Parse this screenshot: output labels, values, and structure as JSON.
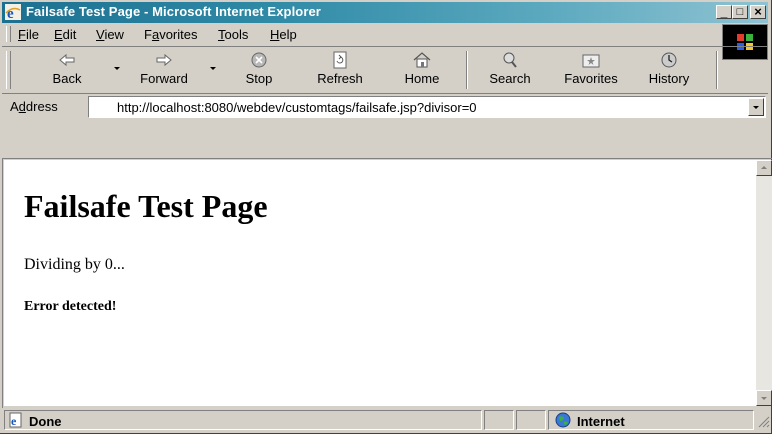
{
  "window": {
    "title": "Failsafe Test Page - Microsoft Internet Explorer",
    "min_glyph": "_",
    "max_glyph": "□",
    "close_glyph": "×"
  },
  "menu": {
    "items": [
      {
        "underline": "F",
        "rest": "ile"
      },
      {
        "underline": "E",
        "rest": "dit"
      },
      {
        "underline": "V",
        "rest": "iew"
      },
      {
        "pre": "F",
        "underline": "a",
        "rest": "vorites"
      },
      {
        "underline": "T",
        "rest": "ools"
      },
      {
        "underline": "H",
        "rest": "elp"
      }
    ]
  },
  "toolbar": {
    "back": "Back",
    "forward": "Forward",
    "stop": "Stop",
    "refresh": "Refresh",
    "home": "Home",
    "search": "Search",
    "favorites": "Favorites",
    "history": "History",
    "more": "»"
  },
  "address": {
    "label_u": "d",
    "label_pre": "A",
    "label_rest": "dress",
    "url": "http://localhost:8080/webdev/customtags/failsafe.jsp?divisor=0"
  },
  "page": {
    "heading": "Failsafe Test Page",
    "line1": "Dividing by 0...",
    "line2": "Error detected!"
  },
  "status": {
    "text": "Done",
    "zone": "Internet"
  },
  "colors": {
    "title_start": "#1c7090",
    "title_end": "#8ec3d2",
    "chrome": "#d4d0c8"
  }
}
